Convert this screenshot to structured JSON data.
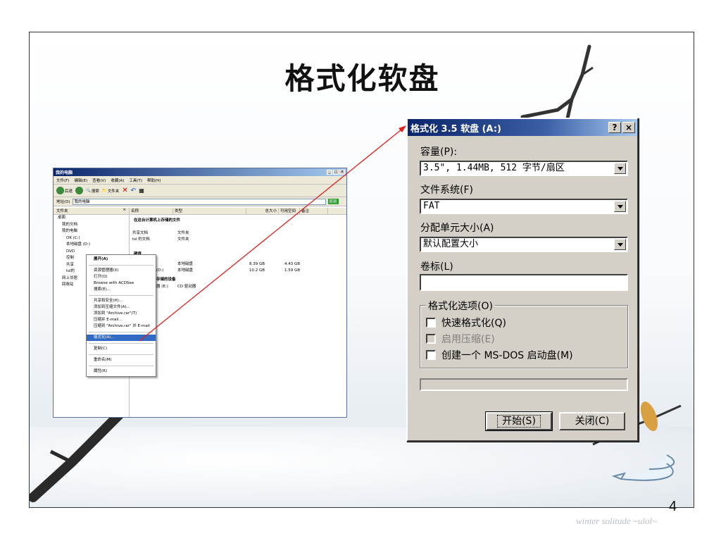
{
  "slide": {
    "title": "格式化软盘",
    "page_number": "4",
    "watermark": "winter solitude ~ulol~"
  },
  "explorer": {
    "title": "我的电脑",
    "window_buttons": [
      "_",
      "□",
      "×"
    ],
    "menu": [
      "文件(F)",
      "编辑(E)",
      "查看(V)",
      "收藏(A)",
      "工具(T)",
      "帮助(H)"
    ],
    "toolbar": {
      "back": "后退",
      "search": "搜索",
      "folders": "文件夹"
    },
    "address_label": "地址(D)",
    "address_value": "我的电脑",
    "go_label": "转到",
    "left_header": "文件夹",
    "tree": [
      "桌面",
      "我的文档",
      "我的电脑",
      "OK (C:)",
      "本地磁盘 (D:)",
      "DVD",
      "控制",
      "共享",
      "tsl的",
      "网上邻居",
      "回收站"
    ],
    "columns": [
      "名称",
      "类型",
      "总大小",
      "可用空间",
      "备注"
    ],
    "group_stored": "在这台计算机上存储的文件",
    "stored_rows": [
      {
        "name": "共享文档",
        "type": "文件夹"
      },
      {
        "name": "tsl 的文档",
        "type": "文件夹"
      }
    ],
    "group_hdd": "硬盘",
    "disk_rows": [
      {
        "name": "",
        "type": "本地磁盘",
        "total": "8.39 GB",
        "free": "4.43 GB"
      },
      {
        "name": "(D:)",
        "type": "本地磁盘",
        "total": "10.2 GB",
        "free": "1.59 GB"
      }
    ],
    "group_removable": "存储的设备",
    "removable_row": {
      "name": "器 (E:)",
      "type": "CD 驱动器"
    }
  },
  "context_menu": {
    "items": [
      "展开(A)",
      "资源管理器(X)",
      "打开(O)",
      "Browse with ACDSee",
      "搜索(E)...",
      "共享和安全(H)...",
      "添加到压缩文件(A)...",
      "添加到 \"Archive.rar\"(T)",
      "压缩并 E-mail...",
      "压缩到 \"Archive.rar\" 并 E-mail",
      "格式化(A)...",
      "复制(C)",
      "重命名(M)",
      "属性(R)"
    ],
    "selected": "格式化(A)..."
  },
  "format_dialog": {
    "title": "格式化 3.5 软盘 (A:)",
    "help_button": "?",
    "close_button": "×",
    "capacity_label": "容量(P):",
    "capacity_value": "3.5\", 1.44MB, 512 字节/扇区",
    "fs_label": "文件系统(F)",
    "fs_value": "FAT",
    "alloc_label": "分配单元大小(A)",
    "alloc_value": "默认配置大小",
    "volume_label": "卷标(L)",
    "volume_value": "",
    "options_legend": "格式化选项(O)",
    "opt_quick": "快速格式化(Q)",
    "opt_compress": "启用压缩(E)",
    "opt_msdos": "创建一个 MS-DOS 启动盘(M)",
    "start_button": "开始(S)",
    "close_label": "关闭(C)"
  },
  "colors": {
    "title_bar": "#0a246a",
    "dialog_face": "#d4d0c8",
    "arrow": "#e0201a",
    "selection": "#316ac5"
  }
}
